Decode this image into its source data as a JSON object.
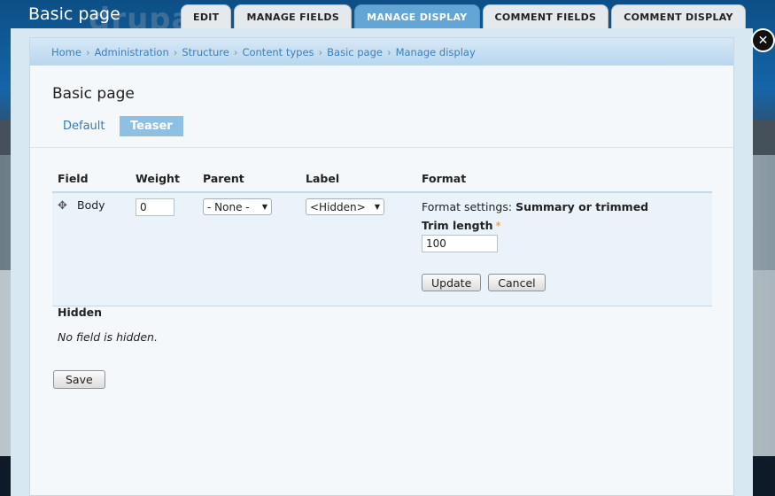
{
  "overlay": {
    "title": "Basic page",
    "tabs": [
      {
        "label": "EDIT",
        "active": false
      },
      {
        "label": "MANAGE FIELDS",
        "active": false
      },
      {
        "label": "MANAGE DISPLAY",
        "active": true
      },
      {
        "label": "COMMENT FIELDS",
        "active": false
      },
      {
        "label": "COMMENT DISPLAY",
        "active": false
      }
    ],
    "close_label": "✕"
  },
  "breadcrumb": [
    "Home",
    "Administration",
    "Structure",
    "Content types",
    "Basic page",
    "Manage display"
  ],
  "breadcrumb_separator": "›",
  "page_title": "Basic page",
  "subtabs": [
    {
      "label": "Default",
      "active": false
    },
    {
      "label": "Teaser",
      "active": true
    }
  ],
  "table": {
    "headers": [
      "Field",
      "Weight",
      "Parent",
      "Label",
      "Format"
    ],
    "rows": [
      {
        "field": "Body",
        "weight": "0",
        "parent": "- None -",
        "label": "<Hidden>",
        "format_settings_prefix": "Format settings:",
        "format_settings_value": "Summary or trimmed",
        "trim_length_label": "Trim length",
        "required_marker": "*",
        "trim_length_value": "100",
        "update_label": "Update",
        "cancel_label": "Cancel"
      }
    ]
  },
  "hidden_section": {
    "title": "Hidden",
    "empty_text": "No field is hidden."
  },
  "save_label": "Save",
  "colors": {
    "accent": "#63a5d4",
    "link": "#3a7fbf",
    "required": "#e09b1d"
  }
}
